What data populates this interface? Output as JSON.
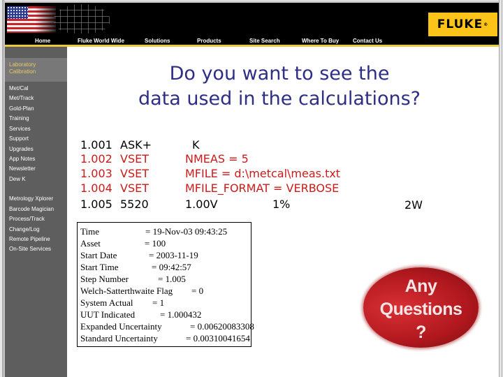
{
  "header": {
    "logo_text": "FLUKE",
    "logo_reg": "®",
    "brand_color": "#fcc419",
    "nav": [
      {
        "label": "Home"
      },
      {
        "label": "Fluke World Wide"
      },
      {
        "label": "Solutions"
      },
      {
        "label": "Products"
      },
      {
        "label": "Site Search"
      },
      {
        "label": "Where To Buy"
      },
      {
        "label": "Contact Us"
      }
    ]
  },
  "sidebar": {
    "header": {
      "line1": "Laboratory",
      "line2": "Calibration"
    },
    "items": [
      {
        "label": "Met/Cal"
      },
      {
        "label": "Met/Track"
      },
      {
        "label": "Gold-Plan"
      },
      {
        "label": "Training"
      },
      {
        "label": "Services"
      },
      {
        "label": "Support"
      },
      {
        "label": "Upgrades"
      },
      {
        "label": "App Notes"
      },
      {
        "label": "Newsletter"
      },
      {
        "label": "Dew K"
      },
      {
        "label": "Metrology Xplorer"
      },
      {
        "label": "Barcode Magician"
      },
      {
        "label": "Process/Track"
      },
      {
        "label": "Change/Log"
      },
      {
        "label": "Remote Pipeline"
      },
      {
        "label": "On-Site Services"
      }
    ]
  },
  "main": {
    "title_line1": "Do you want to see the",
    "title_line2": "data used in the calculations?",
    "procedure_steps": [
      {
        "step": "1.001",
        "fsc": "ASK+",
        "expr": "K",
        "tol": "",
        "color": "black"
      },
      {
        "step": "1.002",
        "fsc": "VSET",
        "expr": "NMEAS = 5",
        "tol": "",
        "color": "red"
      },
      {
        "step": "1.003",
        "fsc": "VSET",
        "expr": "MFILE = d:\\metcal\\meas.txt",
        "tol": "",
        "color": "red"
      },
      {
        "step": "1.004",
        "fsc": "VSET",
        "expr": "MFILE_FORMAT = VERBOSE",
        "tol": "",
        "color": "red"
      },
      {
        "step": "1.005",
        "fsc": "5520",
        "expr": "1.00V",
        "tol": "1%",
        "color": "black"
      }
    ],
    "step_extra": "2W",
    "highlight_color": "#cc1a1a",
    "results": [
      {
        "label": "Time",
        "value": "= 19-Nov-03 09:43:25"
      },
      {
        "label": "Asset",
        "value": "= 100"
      },
      {
        "label": "Start Date",
        "value": "= 2003-11-19"
      },
      {
        "label": "Start Time",
        "value": "= 09:42:57"
      },
      {
        "label": "Step Number",
        "value": "= 1.005"
      },
      {
        "label": "Welch-Satterthwaite Flag",
        "value": "= 0"
      },
      {
        "label": "System Actual",
        "value": "= 1"
      },
      {
        "label": "UUT Indicated",
        "value": "= 1.000432"
      },
      {
        "label": "Expanded Uncertainty",
        "value": "= 0.00620083308"
      },
      {
        "label": "Standard Uncertainty",
        "value": "= 0.00310041654"
      }
    ],
    "questions_graphic": {
      "line1": "Any",
      "line2": "Questions",
      "line3": "?"
    }
  }
}
